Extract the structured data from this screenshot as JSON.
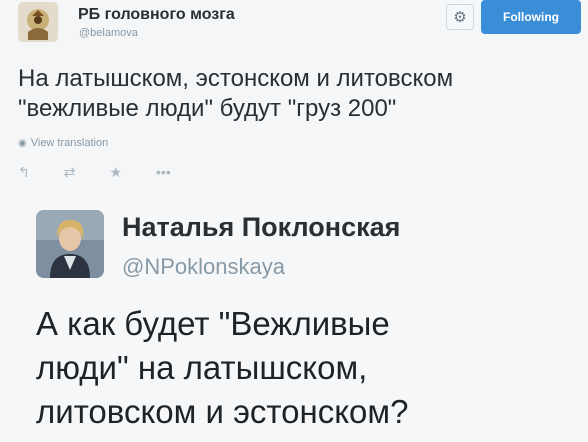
{
  "tweet1": {
    "author_name": "РБ головного мозга",
    "handle": "@belamova",
    "follow_label": "Following",
    "text_line1": "На латышском, эстонском и литовском",
    "text_line2": "\"вежливые люди\" будут \"груз 200\"",
    "translate_label": "View translation",
    "icons": [
      "reply-icon",
      "retweet-icon",
      "favorite-icon",
      "more-icon",
      "gear-icon"
    ]
  },
  "tweet2": {
    "author_name": "Наталья Поклонская",
    "handle": "@NPoklonskaya",
    "text_line1": "А как будет \"Вежливые",
    "text_line2": "люди\" на латышском,",
    "text_line3": "литовском и эстонском?"
  },
  "colors": {
    "follow_button": "#3a8ed8",
    "muted_text": "#8899a6",
    "body_text": "#292f33"
  }
}
